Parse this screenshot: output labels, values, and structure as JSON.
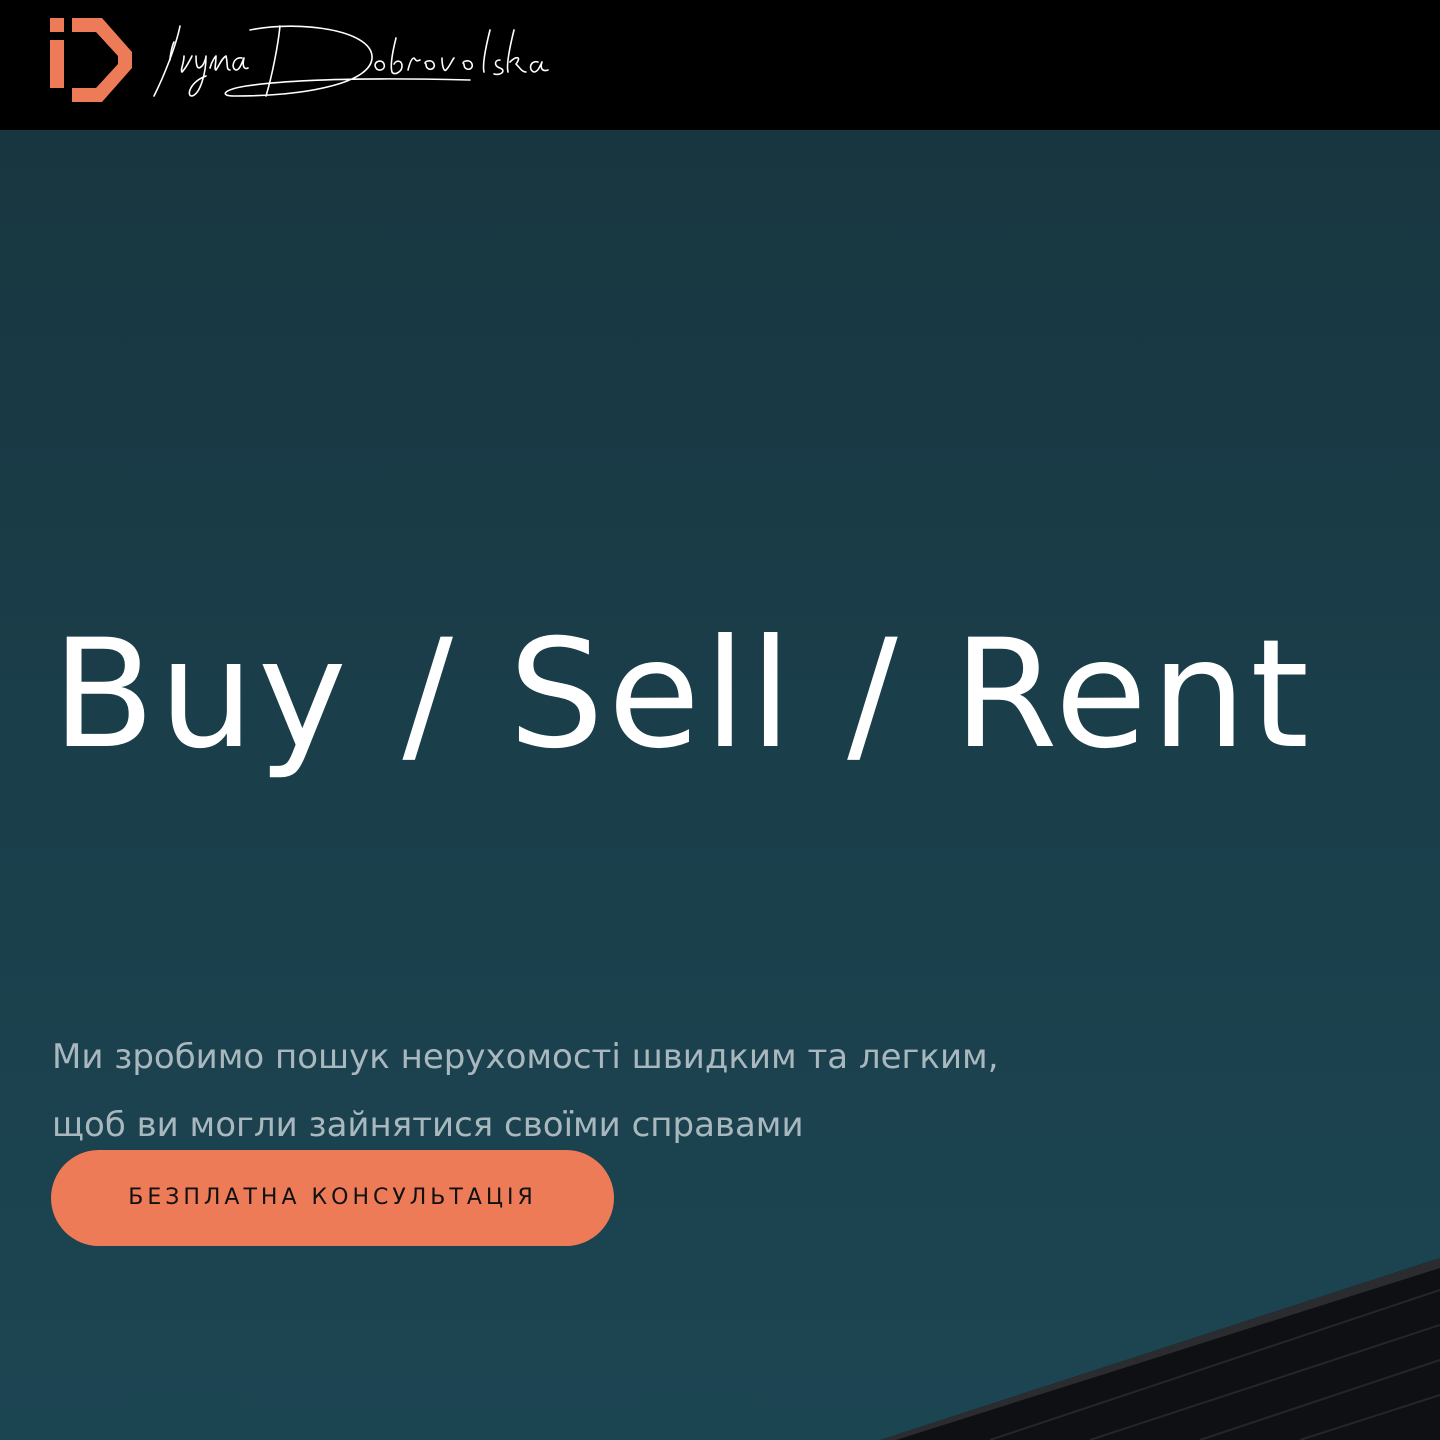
{
  "header": {
    "logo_icon": "id-monogram-logo",
    "signature_text": "Iryna Dobrovolska"
  },
  "hero": {
    "headline": "Buy / Sell / Rent",
    "subtitle_lines": [
      "Ми зробимо пошук нерухомості швидким та легким,",
      "щоб ви могли зайнятися своїми справами"
    ],
    "cta_label": "БЕЗПЛАТНА КОНСУЛЬТАЦІЯ"
  },
  "colors": {
    "accent": "#ee7b58",
    "header_bg": "#000000",
    "hero_bg": "#1b3a47",
    "headline": "#ffffff",
    "subtitle": "#a9b8be"
  }
}
